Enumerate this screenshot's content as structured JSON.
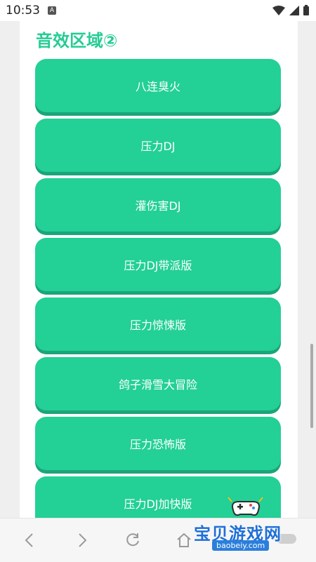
{
  "status_bar": {
    "time": "10:53",
    "notification_letter": "A"
  },
  "section": {
    "title": "音效区域②"
  },
  "sound_buttons": [
    {
      "label": "八连臭火"
    },
    {
      "label": "压力DJ"
    },
    {
      "label": "灌伤害DJ"
    },
    {
      "label": "压力DJ带派版"
    },
    {
      "label": "压力惊悚版"
    },
    {
      "label": "鸽子滑雪大冒险"
    },
    {
      "label": "压力恐怖版"
    },
    {
      "label": "压力DJ加快版"
    }
  ],
  "watermark": {
    "title": "宝贝游戏网",
    "url": "baobeiy.com"
  },
  "toolbar": {
    "icons": [
      "back-icon",
      "forward-icon",
      "refresh-icon",
      "home-icon"
    ]
  },
  "colors": {
    "accent": "#23d095",
    "accent_dark": "#1aa57a",
    "title": "#25cc93"
  }
}
